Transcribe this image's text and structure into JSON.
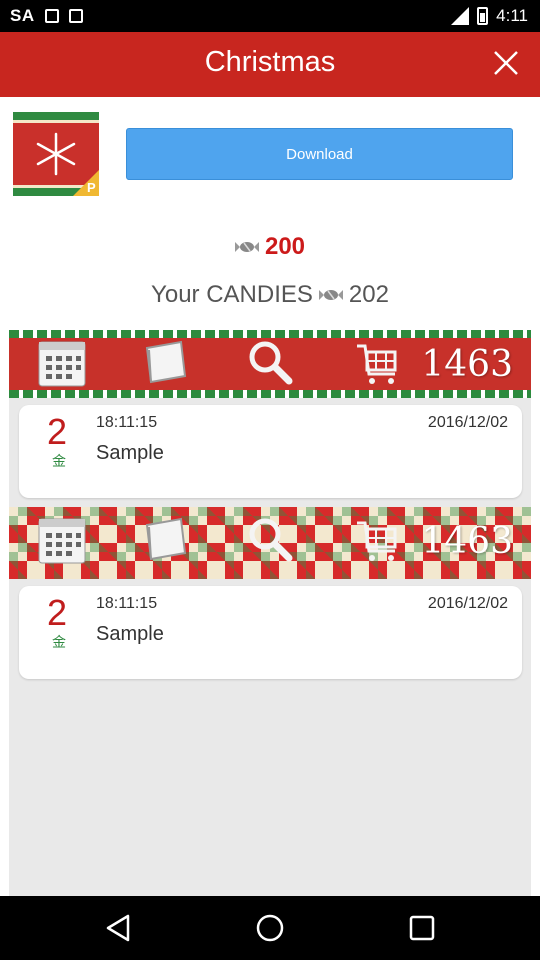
{
  "status_bar": {
    "carrier": "SA",
    "time": "4:11"
  },
  "header": {
    "title": "Christmas"
  },
  "download": {
    "label": "Download"
  },
  "price": {
    "value": "200"
  },
  "your_candies": {
    "label": "Your CANDIES",
    "value": "202"
  },
  "banners": [
    {
      "count": "1463",
      "icons": [
        "calendar-icon",
        "book-icon",
        "search-icon",
        "cart-icon"
      ]
    },
    {
      "count": "1463",
      "icons": [
        "calendar-icon",
        "book-icon",
        "search-icon",
        "cart-icon"
      ]
    }
  ],
  "items": [
    {
      "number": "2",
      "unit": "金",
      "time": "18:11:15",
      "date": "2016/12/02",
      "name": "Sample"
    },
    {
      "number": "2",
      "unit": "金",
      "time": "18:11:15",
      "date": "2016/12/02",
      "name": "Sample"
    }
  ],
  "colors": {
    "header": "#c8261f",
    "download": "#4fa4ee",
    "accent_red": "#cc1a1a",
    "accent_green": "#2f8a41"
  }
}
